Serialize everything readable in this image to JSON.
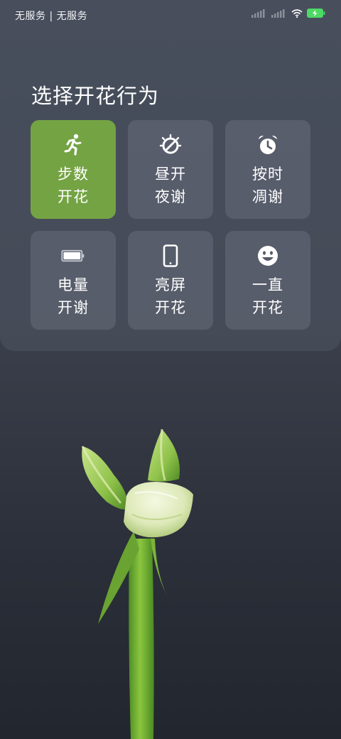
{
  "status_bar": {
    "carrier": "无服务 | 无服务",
    "battery_charging": true,
    "battery_color": "#4cd964"
  },
  "panel": {
    "title": "选择开花行为",
    "accent_color": "#74a344",
    "options": [
      {
        "icon": "running-person-icon",
        "line1": "步数",
        "line2": "开花",
        "selected": true
      },
      {
        "icon": "sun-slash-icon",
        "line1": "昼开",
        "line2": "夜谢",
        "selected": false
      },
      {
        "icon": "alarm-clock-icon",
        "line1": "按时",
        "line2": "凋谢",
        "selected": false
      },
      {
        "icon": "battery-icon",
        "line1": "电量",
        "line2": "开谢",
        "selected": false
      },
      {
        "icon": "phone-icon",
        "line1": "亮屏",
        "line2": "开花",
        "selected": false
      },
      {
        "icon": "smiley-icon",
        "line1": "一直",
        "line2": "开花",
        "selected": false
      }
    ]
  }
}
